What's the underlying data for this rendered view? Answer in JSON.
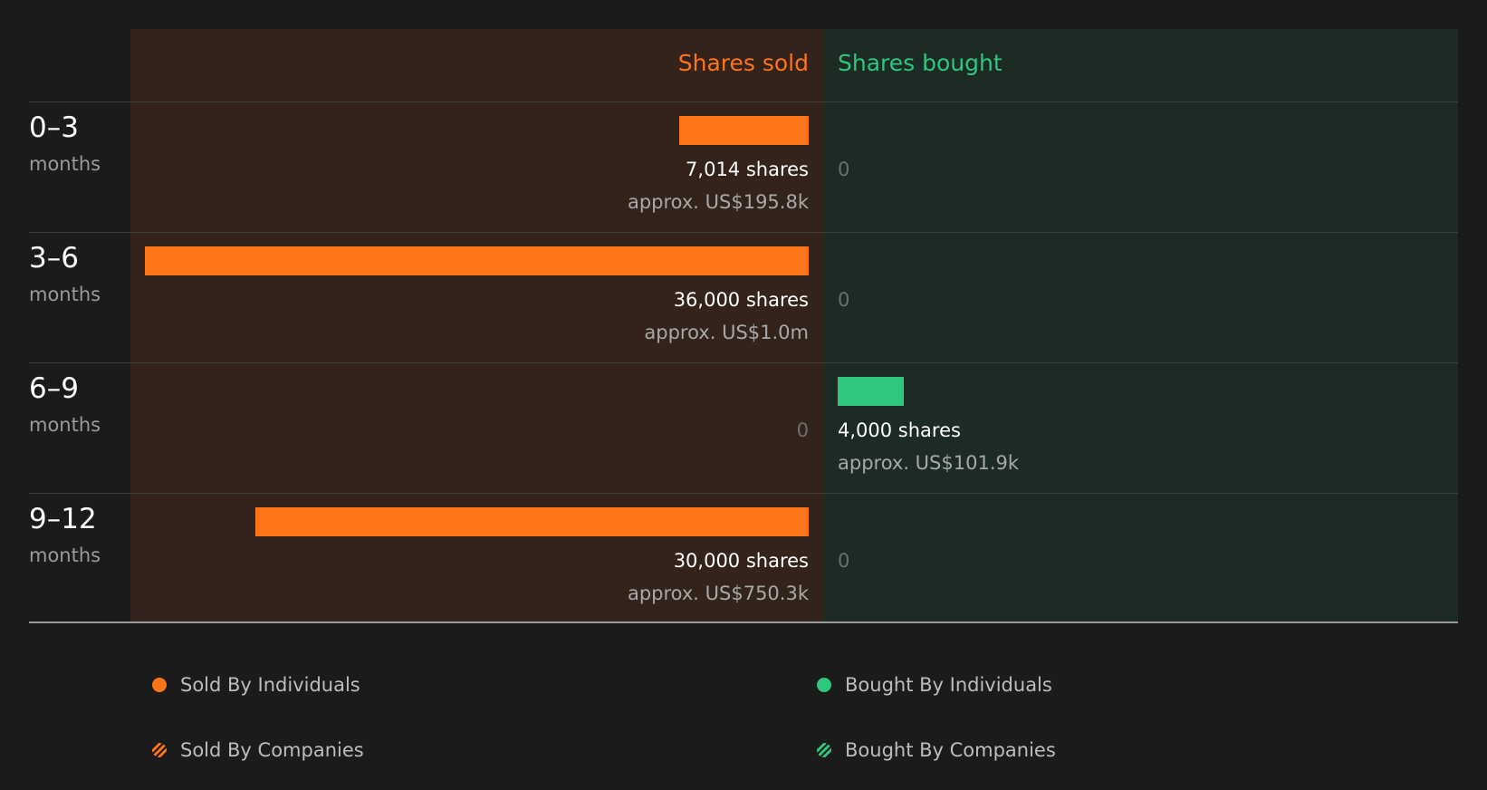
{
  "chart_data": {
    "type": "bar",
    "orientation": "horizontal-diverging",
    "categories": [
      {
        "range": "0–3",
        "unit": "months"
      },
      {
        "range": "3–6",
        "unit": "months"
      },
      {
        "range": "6–9",
        "unit": "months"
      },
      {
        "range": "9–12",
        "unit": "months"
      }
    ],
    "series": [
      {
        "name": "Shares sold",
        "values": [
          7014,
          36000,
          0,
          30000
        ],
        "labels": [
          "7,014 shares",
          "36,000 shares",
          "0",
          "30,000 shares"
        ],
        "approx": [
          "approx. US$195.8k",
          "approx. US$1.0m",
          "",
          "approx. US$750.3k"
        ],
        "color": "#ff7417"
      },
      {
        "name": "Shares bought",
        "values": [
          0,
          0,
          4000,
          0
        ],
        "labels": [
          "0",
          "0",
          "4,000 shares",
          "0"
        ],
        "approx": [
          "",
          "",
          "approx. US$101.9k",
          ""
        ],
        "color": "#2dc77e"
      }
    ],
    "grid": false
  },
  "legend": [
    {
      "label": "Sold By Individuals",
      "marker": "dot",
      "color": "#ff7417"
    },
    {
      "label": "Bought By Individuals",
      "marker": "dot",
      "color": "#2dc77e"
    },
    {
      "label": "Sold By Companies",
      "marker": "hatched-dot",
      "color": "#ff7417"
    },
    {
      "label": "Bought By Companies",
      "marker": "hatched-dot",
      "color": "#2dc77e"
    }
  ]
}
